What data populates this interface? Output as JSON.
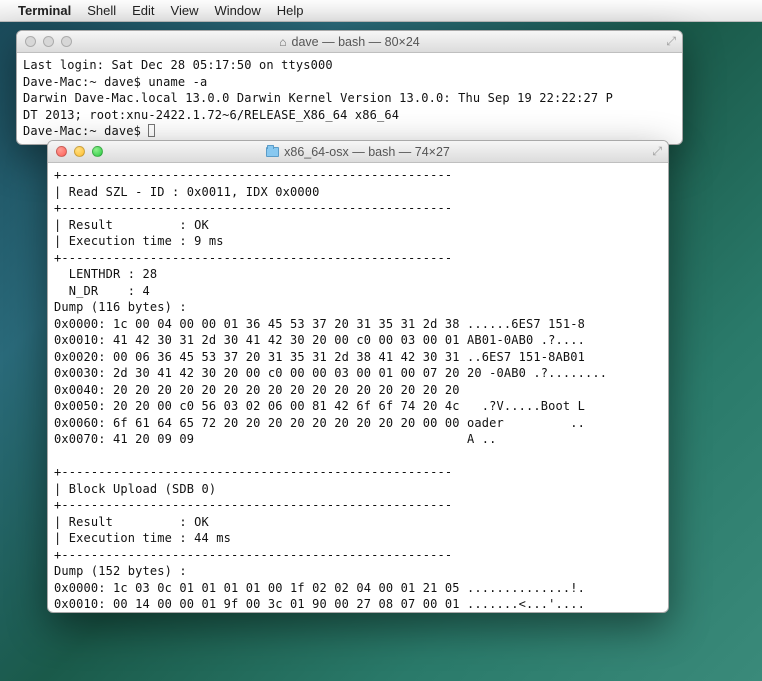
{
  "menubar": {
    "items": [
      "Terminal",
      "Shell",
      "Edit",
      "View",
      "Window",
      "Help"
    ]
  },
  "window1": {
    "title": "dave — bash — 80×24",
    "lines": [
      "Last login: Sat Dec 28 05:17:50 on ttys000",
      "Dave-Mac:~ dave$ uname -a",
      "Darwin Dave-Mac.local 13.0.0 Darwin Kernel Version 13.0.0: Thu Sep 19 22:22:27 P",
      "DT 2013; root:xnu-2422.1.72~6/RELEASE_X86_64 x86_64",
      "Dave-Mac:~ dave$ "
    ]
  },
  "window2": {
    "title": "x86_64-osx — bash — 74×27",
    "lines": [
      "+-----------------------------------------------------",
      "| Read SZL - ID : 0x0011, IDX 0x0000",
      "+-----------------------------------------------------",
      "| Result         : OK",
      "| Execution time : 9 ms",
      "+-----------------------------------------------------",
      "  LENTHDR : 28",
      "  N_DR    : 4",
      "Dump (116 bytes) :",
      "0x0000: 1c 00 04 00 00 01 36 45 53 37 20 31 35 31 2d 38 ......6ES7 151-8",
      "0x0010: 41 42 30 31 2d 30 41 42 30 20 00 c0 00 03 00 01 AB01-0AB0 .?....",
      "0x0020: 00 06 36 45 53 37 20 31 35 31 2d 38 41 42 30 31 ..6ES7 151-8AB01",
      "0x0030: 2d 30 41 42 30 20 00 c0 00 00 03 00 01 00 07 20 20 -0AB0 .?........",
      "0x0040: 20 20 20 20 20 20 20 20 20 20 20 20 20 20 20 20",
      "0x0050: 20 20 00 c0 56 03 02 06 00 81 42 6f 6f 74 20 4c   .?V.....Boot L",
      "0x0060: 6f 61 64 65 72 20 20 20 20 20 20 20 20 20 00 00 oader         ..",
      "0x0070: 41 20 09 09                                     A ..",
      "",
      "+-----------------------------------------------------",
      "| Block Upload (SDB 0)",
      "+-----------------------------------------------------",
      "| Result         : OK",
      "| Execution time : 44 ms",
      "+-----------------------------------------------------",
      "Dump (152 bytes) :",
      "0x0000: 1c 03 0c 01 01 01 01 00 1f 02 02 04 00 01 21 05 ..............!.",
      "0x0010: 00 14 00 00 01 9f 00 3c 01 90 00 27 08 07 00 01 .......<...'...."
    ]
  }
}
